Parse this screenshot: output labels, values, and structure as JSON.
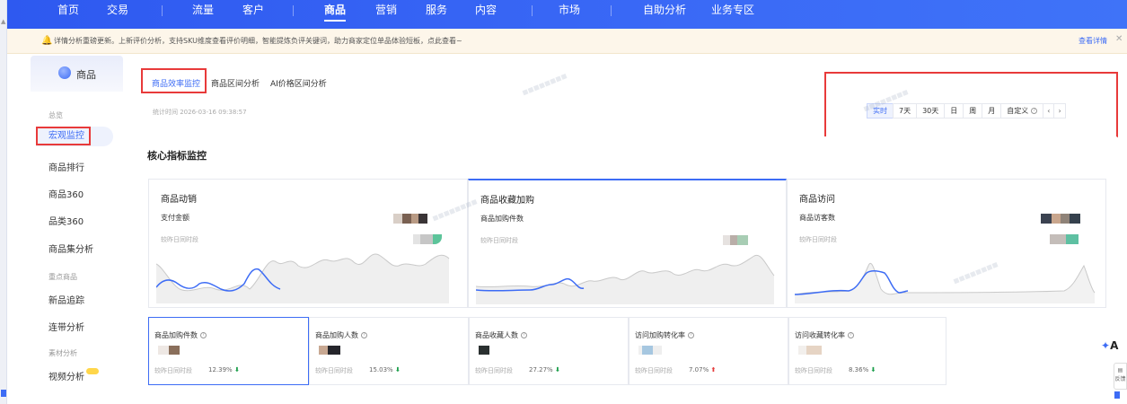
{
  "topnav": {
    "items": [
      "首页",
      "交易",
      "流量",
      "客户",
      "商品",
      "营销",
      "服务",
      "内容",
      "市场",
      "自助分析",
      "业务专区"
    ],
    "active_index": 4
  },
  "notice": {
    "text": "详情分析重磅更新。上新评价分析，支持SKU维度查看评价明细，智能提炼负评关键词，助力商家定位单品体验短板，点此查看~",
    "link": "查看详情"
  },
  "sidebar": {
    "title": "商品",
    "group_overview": "总览",
    "items_top": [
      "宏观监控",
      "商品排行",
      "商品360",
      "品类360",
      "商品集分析"
    ],
    "group_key": "重点商品",
    "items_key": [
      "新品追踪",
      "连带分析"
    ],
    "group_material": "素材分析",
    "items_material": [
      "视频分析"
    ]
  },
  "main": {
    "tabs": [
      "商品效率监控",
      "商品区间分析",
      "AI价格区间分析"
    ],
    "stat_time": "统计时间 2026-03-16 09:38:57",
    "date_buttons": [
      "实时",
      "7天",
      "30天",
      "日",
      "周",
      "月",
      "自定义"
    ],
    "section_title": "核心指标监控"
  },
  "cards": [
    {
      "title": "商品动销",
      "metric": "支付金额",
      "compare": "较昨日同时段"
    },
    {
      "title": "商品收藏加购",
      "metric": "商品加购件数",
      "compare": "较昨日同时段"
    },
    {
      "title": "商品访问",
      "metric": "商品访客数",
      "compare": "较昨日同时段"
    }
  ],
  "minis": [
    {
      "title": "商品加购件数",
      "compare": "较昨日同时段",
      "pct": "12.39%",
      "dir": "down"
    },
    {
      "title": "商品加购人数",
      "compare": "较昨日同时段",
      "pct": "15.03%",
      "dir": "down"
    },
    {
      "title": "商品收藏人数",
      "compare": "较昨日同时段",
      "pct": "27.27%",
      "dir": "down"
    },
    {
      "title": "访问加购转化率",
      "compare": "较昨日同时段",
      "pct": "7.07%",
      "dir": "up"
    },
    {
      "title": "访问收藏转化率",
      "compare": "较昨日同时段",
      "pct": "8.36%",
      "dir": "down"
    }
  ],
  "floating": {
    "ai_label": "A",
    "tool_label": "反馈"
  },
  "colors": {
    "accent": "#3d6cf5",
    "nav": "#3a69f6",
    "highlight": "#e83a3a",
    "down": "#1a9e4a",
    "up": "#e53d3d"
  }
}
